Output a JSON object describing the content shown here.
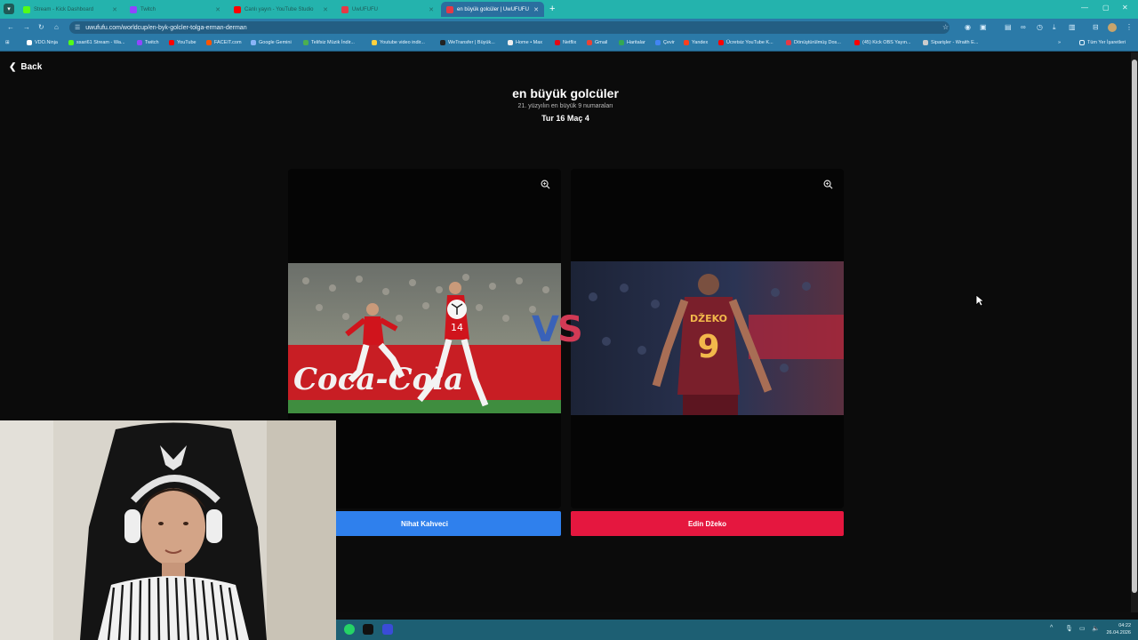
{
  "browser": {
    "tabs": [
      {
        "label": "Stream - Kick Dashboard",
        "color": "#53fc18"
      },
      {
        "label": "Twitch",
        "color": "#9146ff"
      },
      {
        "label": "Canlı yayın - YouTube Studio",
        "color": "#ff0000"
      },
      {
        "label": "UwUFUFU",
        "color": "#e53946"
      },
      {
        "label": "en büyük golcüler | UwUFUFU",
        "color": "#e53946"
      }
    ],
    "url": "uwufufu.com/worldcup/en-byk-golcler-tolga-erman-derman",
    "bookmarks": [
      {
        "label": "VDO.Ninja",
        "color": "#ffffff"
      },
      {
        "label": "ssari61 Stream - Wa...",
        "color": "#53fc18"
      },
      {
        "label": "Twitch",
        "color": "#9146ff"
      },
      {
        "label": "YouTube",
        "color": "#ff0000"
      },
      {
        "label": "FACEIT.com",
        "color": "#ff5500"
      },
      {
        "label": "Google Gemini",
        "color": "#8ab4f8"
      },
      {
        "label": "Telifsiz Müzik İndir...",
        "color": "#4caf50"
      },
      {
        "label": "Youtube video indir...",
        "color": "#ffd23f"
      },
      {
        "label": "WeTransfer | Büyük...",
        "color": "#222222"
      },
      {
        "label": "Home • Max",
        "color": "#111111"
      },
      {
        "label": "Netflix",
        "color": "#e50914"
      },
      {
        "label": "Gmail",
        "color": "#ea4335"
      },
      {
        "label": "Haritalar",
        "color": "#34a853"
      },
      {
        "label": "Çevir",
        "color": "#4285f4"
      },
      {
        "label": "Yandex",
        "color": "#fc3f1d"
      },
      {
        "label": "Ücretsiz YouTube K...",
        "color": "#ff0000"
      },
      {
        "label": "Dönüştürülmüş Dos...",
        "color": "#e53946"
      },
      {
        "label": "(45) Kick OBS Yayın...",
        "color": "#ff0000"
      },
      {
        "label": "Siparişler - Wraith E...",
        "color": "#cccccc"
      }
    ],
    "all_bookmarks": "Tüm Yer İşaretleri"
  },
  "page": {
    "back": "Back",
    "title": "en büyük golcüler",
    "subtitle": "21. yüzyılın en büyük 9 numaraları",
    "round": "Tur 16 Maç 4",
    "vs_left": "V",
    "vs_right": "S",
    "left_choice": "Nihat Kahveci",
    "right_choice": "Edin Džeko",
    "right_jersey_name": "DŽEKO",
    "right_jersey_number": "9",
    "left_jersey_number": "14",
    "colors": {
      "blue": "#2f80ed",
      "red": "#e5173f"
    }
  },
  "taskbar": {
    "time": "04:22",
    "date": "26.04.2026"
  }
}
